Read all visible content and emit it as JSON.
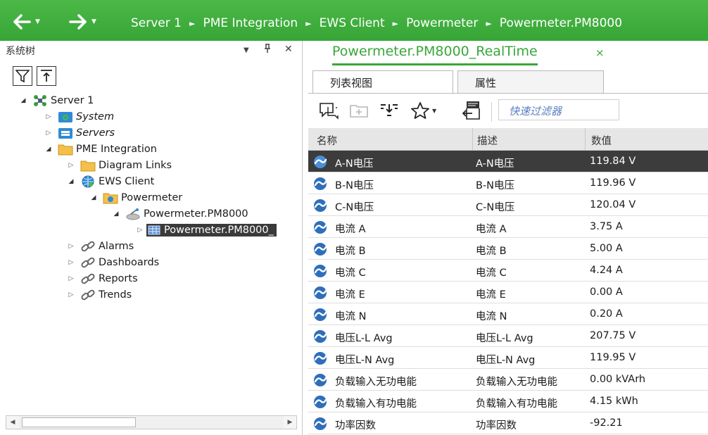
{
  "topbar": {
    "breadcrumbs": [
      "Server 1",
      "PME Integration",
      "EWS Client",
      "Powermeter",
      "Powermeter.PM8000"
    ],
    "separator": "►",
    "dropdown_caret": "▼"
  },
  "left_panel": {
    "title": "系统树",
    "pin_glyph": "▼",
    "dock_glyph": "ᚙ",
    "close_glyph": "✕",
    "tree": [
      {
        "label": "Server 1",
        "expander": "◢"
      },
      {
        "label": "System",
        "expander": "▷"
      },
      {
        "label": "Servers",
        "expander": "▷"
      },
      {
        "label": "PME Integration",
        "expander": "◢"
      },
      {
        "label": "Diagram Links",
        "expander": "▷"
      },
      {
        "label": "EWS Client",
        "expander": "◢"
      },
      {
        "label": "Powermeter",
        "expander": "◢"
      },
      {
        "label": "Powermeter.PM8000",
        "expander": "◢"
      },
      {
        "label": "Powermeter.PM8000_",
        "expander": "▷"
      },
      {
        "label": "Alarms",
        "expander": "▷"
      },
      {
        "label": "Dashboards",
        "expander": "▷"
      },
      {
        "label": "Reports",
        "expander": "▷"
      },
      {
        "label": "Trends",
        "expander": "▷"
      }
    ],
    "scroll_left": "◀",
    "scroll_right": "▶"
  },
  "right_panel": {
    "document_tab": "Powermeter.PM8000_RealTime",
    "document_close": "×",
    "view_tabs": [
      "列表视图",
      "属性"
    ],
    "toolbar_caret": "▼",
    "filter_placeholder": "快速过滤器",
    "columns": [
      "名称",
      "描述",
      "数值"
    ],
    "rows": [
      {
        "name": "A-N电压",
        "desc": "A-N电压",
        "value": "119.84 V"
      },
      {
        "name": "B-N电压",
        "desc": "B-N电压",
        "value": "119.96 V"
      },
      {
        "name": "C-N电压",
        "desc": "C-N电压",
        "value": "120.04 V"
      },
      {
        "name": "电流 A",
        "desc": "电流 A",
        "value": "3.75 A"
      },
      {
        "name": "电流 B",
        "desc": "电流 B",
        "value": "5.00 A"
      },
      {
        "name": "电流 C",
        "desc": "电流 C",
        "value": "4.24 A"
      },
      {
        "name": "电流 E",
        "desc": "电流 E",
        "value": "0.00 A"
      },
      {
        "name": "电流 N",
        "desc": "电流 N",
        "value": "0.20 A"
      },
      {
        "name": "电压L-L Avg",
        "desc": "电压L-L Avg",
        "value": "207.75 V"
      },
      {
        "name": "电压L-N Avg",
        "desc": "电压L-N Avg",
        "value": "119.95 V"
      },
      {
        "name": "负载输入无功电能",
        "desc": "负载输入无功电能",
        "value": "0.00 kVArh"
      },
      {
        "name": "负载输入有功电能",
        "desc": "负载输入有功电能",
        "value": "4.15 kWh"
      },
      {
        "name": "功率因数",
        "desc": "功率因数",
        "value": "-92.21"
      }
    ]
  },
  "colors": {
    "brand_green": "#3aa63a",
    "selection": "#3c3c3c",
    "header_gray": "#e6e6e6"
  }
}
